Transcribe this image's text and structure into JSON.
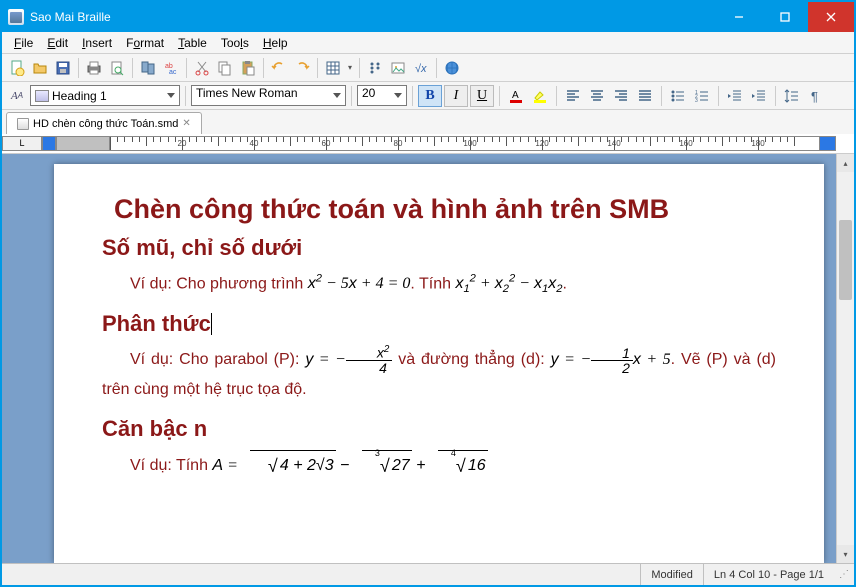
{
  "window": {
    "title": "Sao Mai Braille"
  },
  "menu": {
    "file": "File",
    "edit": "Edit",
    "insert": "Insert",
    "format": "Format",
    "table": "Table",
    "tools": "Tools",
    "help": "Help"
  },
  "format_toolbar": {
    "style": "Heading 1",
    "font": "Times New Roman",
    "size": "20",
    "bold": "B",
    "italic": "I",
    "underline": "U"
  },
  "tab": {
    "label": "HD chèn công thức Toán.smd"
  },
  "ruler": {
    "ticks": [
      "20",
      "40",
      "60",
      "80",
      "100",
      "120",
      "140",
      "160",
      "180"
    ]
  },
  "document": {
    "title": "Chèn công thức toán và hình ảnh trên SMB",
    "h2_1": "Số mũ, chỉ số dưới",
    "p1_lead": "Ví dụ: Cho phương trình ",
    "p1_eq1": "x² − 5x + 4 = 0",
    "p1_mid": ". Tính ",
    "p1_eq2_a": "x",
    "p1_eq2_b": "x",
    "p1_eq2_c": "x",
    "p1_eq2_d": "x",
    "h2_2": "Phân thức",
    "p2_lead": "Ví dụ: Cho parabol (P): ",
    "p2_y1": "y = −",
    "p2_frac1_num": "x²",
    "p2_frac1_den": "4",
    "p2_mid": " và đường thẳng (d): ",
    "p2_y2": "y = −",
    "p2_frac2_num": "1",
    "p2_frac2_den": "2",
    "p2_after": "x + 5",
    "p2_tail": ". Vẽ (P) và (d) trên cùng một hệ trục tọa độ.",
    "h2_3": "Căn bậc n",
    "p3_lead": "Ví dụ: Tính ",
    "p3_A": "A = ",
    "p3_s1": "4 + 2√3",
    "p3_minus": " − ",
    "p3_s2": "27",
    "p3_plus": " + ",
    "p3_s3": "16"
  },
  "status": {
    "modified": "Modified",
    "position": "Ln 4 Col 10 - Page 1/1"
  }
}
